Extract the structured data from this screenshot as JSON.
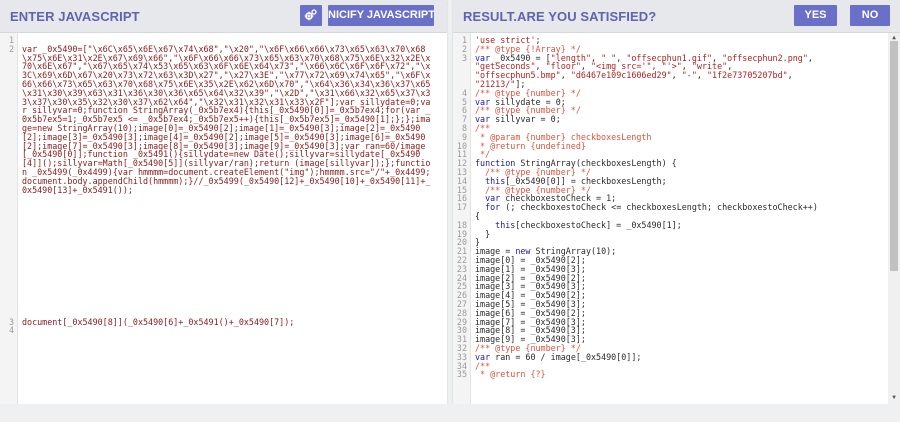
{
  "left": {
    "title": "ENTER JAVASCRIPT",
    "settings_icon": "gears-icon",
    "nicify_label": "NICIFY JAVASCRIPT",
    "lines": [
      {
        "num": "1",
        "text": ""
      },
      {
        "num": "2",
        "text": "var _0x5490=[\"\\x6C\\x65\\x6E\\x67\\x74\\x68\",\"\\x20\",\"\\x6F\\x66\\x66\\x73\\x65\\x63\\x70\\x68\\x75\\x6E\\x31\\x2E\\x67\\x69\\x66\",\"\\x6F\\x66\\x66\\x73\\x65\\x63\\x70\\x68\\x75\\x6E\\x32\\x2E\\x70\\x6E\\x67\",\"\\x67\\x65\\x74\\x53\\x65\\x63\\x6F\\x6E\\x64\\x73\",\"\\x66\\x6C\\x6F\\x6F\\x72\",\"\\x3C\\x69\\x6D\\x67\\x20\\x73\\x72\\x63\\x3D\\x27\",\"\\x27\\x3E\",\"\\x77\\x72\\x69\\x74\\x65\",\"\\x6F\\x66\\x66\\x73\\x65\\x63\\x70\\x68\\x75\\x6E\\x35\\x2E\\x62\\x6D\\x70\",\"\\x64\\x36\\x34\\x36\\x37\\x65\\x31\\x30\\x39\\x63\\x31\\x36\\x30\\x36\\x65\\x64\\x32\\x39\",\"\\x2D\",\"\\x31\\x66\\x32\\x65\\x37\\x33\\x37\\x30\\x35\\x32\\x30\\x37\\x62\\x64\",\"\\x32\\x31\\x32\\x31\\x33\\x2F\"];var sillydate=0;var sillyvar=0;function StringArray(_0x5b7ex4){this[_0x5490[0]]=_0x5b7ex4;for(var _0x5b7ex5=1;_0x5b7ex5 <= _0x5b7ex4;_0x5b7ex5++){this[_0x5b7ex5]=_0x5490[1];};};image=new StringArray(10);image[0]=_0x5490[2];image[1]=_0x5490[3];image[2]=_0x5490[2];image[3]=_0x5490[3];image[4]=_0x5490[2];image[5]=_0x5490[3];image[6]=_0x5490[2];image[7]=_0x5490[3];image[8]=_0x5490[3];image[9]=_0x5490[3];var ran=60/image[_0x5490[0]];function _0x5491(){sillydate=new Date();sillyvar=sillydate[_0x5490[4]]();sillyvar=Math[_0x5490[5]](sillyvar/ran);return (image[sillyvar]);};function _0x5499(_0x4499){var hmmmm=document.createElement(\"img\");hmmmm.src=\"/\"+_0x4499;document.body.appendChild(hmmmm);}//_0x5499(_0x5490[12]+_0x5490[10]+_0x5490[11]+_0x5490[13]+_0x5491());"
      },
      {
        "num": "3",
        "text": "document[_0x5490[8]](_0x5490[6]+_0x5491()+_0x5490[7]);"
      },
      {
        "num": "4",
        "text": ""
      }
    ]
  },
  "right": {
    "title": "RESULT.",
    "subtitle": "ARE YOU SATISFIED?",
    "yes_label": "YES",
    "no_label": "NO",
    "lines": [
      {
        "num": "1",
        "text": "'use strict';"
      },
      {
        "num": "2",
        "text": "/** @type {!Array} */"
      },
      {
        "num": "3",
        "text": "var _0x5490 = [\"length\", \" \", \"offsecphun1.gif\", \"offsecphun2.png\","
      },
      {
        "num": "",
        "text": "\"getSeconds\", \"floor\", \"<img src='\", \"'>\", \"write\","
      },
      {
        "num": "",
        "text": "\"offsecphun5.bmp\", \"d6467e109c1606ed29\", \"-\", \"1f2e73705207bd\","
      },
      {
        "num": "",
        "text": "\"21213/\"];"
      },
      {
        "num": "4",
        "text": "/** @type {number} */"
      },
      {
        "num": "5",
        "text": "var sillydate = 0;"
      },
      {
        "num": "6",
        "text": "/** @type {number} */"
      },
      {
        "num": "7",
        "text": "var sillyvar = 0;"
      },
      {
        "num": "8",
        "text": "/**"
      },
      {
        "num": "9",
        "text": " * @param {number} checkboxesLength"
      },
      {
        "num": "10",
        "text": " * @return {undefined}"
      },
      {
        "num": "11",
        "text": " */"
      },
      {
        "num": "12",
        "text": "function StringArray(checkboxesLength) {"
      },
      {
        "num": "13",
        "text": "  /** @type {number} */"
      },
      {
        "num": "14",
        "text": "  this[_0x5490[0]] = checkboxesLength;"
      },
      {
        "num": "15",
        "text": "  /** @type {number} */"
      },
      {
        "num": "16",
        "text": "  var checkboxestoCheck = 1;"
      },
      {
        "num": "17",
        "text": "  for (; checkboxestoCheck <= checkboxesLength; checkboxestoCheck++)"
      },
      {
        "num": "",
        "text": "{"
      },
      {
        "num": "18",
        "text": "    this[checkboxestoCheck] = _0x5490[1];"
      },
      {
        "num": "19",
        "text": "  }"
      },
      {
        "num": "20",
        "text": "}"
      },
      {
        "num": "21",
        "text": "image = new StringArray(10);"
      },
      {
        "num": "22",
        "text": "image[0] = _0x5490[2];"
      },
      {
        "num": "23",
        "text": "image[1] = _0x5490[3];"
      },
      {
        "num": "24",
        "text": "image[2] = _0x5490[2];"
      },
      {
        "num": "25",
        "text": "image[3] = _0x5490[3];"
      },
      {
        "num": "26",
        "text": "image[4] = _0x5490[2];"
      },
      {
        "num": "27",
        "text": "image[5] = _0x5490[3];"
      },
      {
        "num": "28",
        "text": "image[6] = _0x5490[2];"
      },
      {
        "num": "29",
        "text": "image[7] = _0x5490[3];"
      },
      {
        "num": "30",
        "text": "image[8] = _0x5490[3];"
      },
      {
        "num": "31",
        "text": "image[9] = _0x5490[3];"
      },
      {
        "num": "32",
        "text": "/** @type {number} */"
      },
      {
        "num": "33",
        "text": "var ran = 60 / image[_0x5490[0]];"
      },
      {
        "num": "34",
        "text": "/**"
      },
      {
        "num": "35",
        "text": " * @return {?}"
      }
    ]
  },
  "colors": {
    "header_title": "#5f63b2",
    "button_bg": "#6a6fc8",
    "string": "#b22222",
    "comment": "#e0533c",
    "keyword": "#1a1aa6"
  },
  "scrollbar": {
    "up_icon": "arrow-up-icon",
    "down_icon": "arrow-down-icon"
  }
}
